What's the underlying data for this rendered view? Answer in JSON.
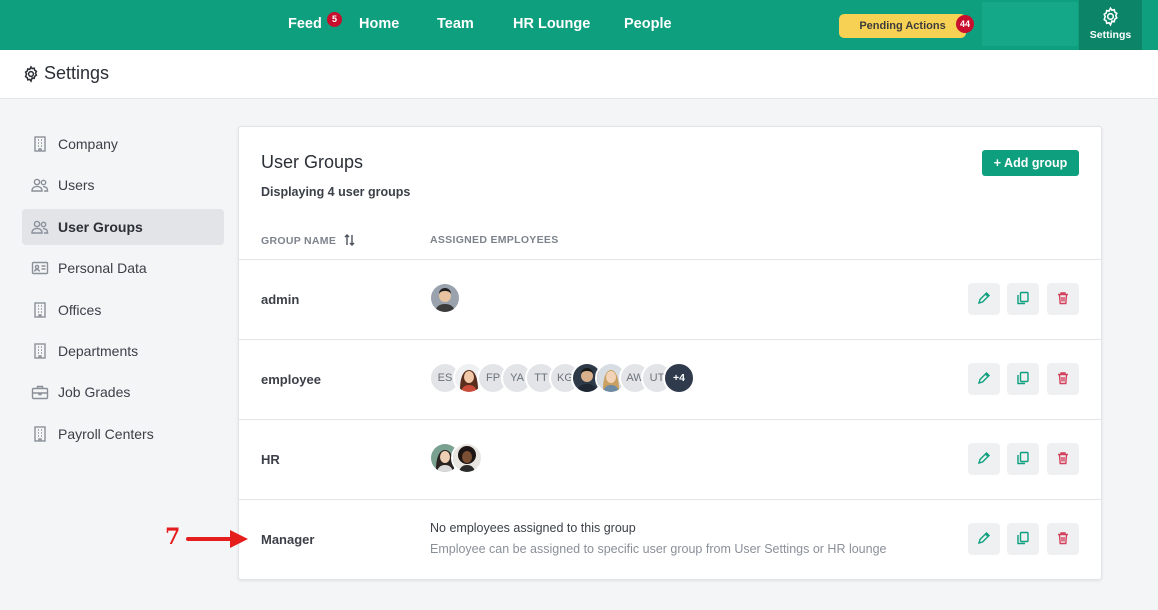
{
  "nav": {
    "links": [
      {
        "label": "Feed",
        "badge": "5"
      },
      {
        "label": "Home"
      },
      {
        "label": "Team"
      },
      {
        "label": "HR Lounge"
      },
      {
        "label": "People"
      }
    ],
    "pending_label": "Pending Actions",
    "pending_count": "44",
    "settings_label": "Settings",
    "settings_icon": "gear-icon"
  },
  "page": {
    "title": "Settings",
    "title_icon": "gear-icon"
  },
  "sidebar": {
    "items": [
      {
        "label": "Company",
        "icon": "building-icon"
      },
      {
        "label": "Users",
        "icon": "users-icon"
      },
      {
        "label": "User Groups",
        "icon": "users-icon",
        "active": true
      },
      {
        "label": "Personal Data",
        "icon": "id-card-icon"
      },
      {
        "label": "Offices",
        "icon": "building-icon"
      },
      {
        "label": "Departments",
        "icon": "building-icon"
      },
      {
        "label": "Job Grades",
        "icon": "briefcase-icon"
      },
      {
        "label": "Payroll Centers",
        "icon": "building-icon"
      }
    ]
  },
  "main": {
    "title": "User Groups",
    "subtitle": "Displaying 4 user groups",
    "add_button": "+ Add group",
    "columns": {
      "group_name": "GROUP NAME",
      "assigned": "ASSIGNED EMPLOYEES"
    },
    "rows": [
      {
        "name": "admin",
        "avatars": [
          {
            "type": "photo"
          }
        ]
      },
      {
        "name": "employee",
        "avatars": [
          {
            "type": "initials",
            "text": "ES"
          },
          {
            "type": "photo"
          },
          {
            "type": "initials",
            "text": "FP"
          },
          {
            "type": "initials",
            "text": "YA"
          },
          {
            "type": "initials",
            "text": "TT"
          },
          {
            "type": "initials",
            "text": "KG"
          },
          {
            "type": "photo"
          },
          {
            "type": "photo"
          },
          {
            "type": "initials",
            "text": "AW"
          },
          {
            "type": "initials",
            "text": "UT"
          },
          {
            "type": "more",
            "text": "+4"
          }
        ]
      },
      {
        "name": "HR",
        "avatars": [
          {
            "type": "photo"
          },
          {
            "type": "photo"
          }
        ]
      },
      {
        "name": "Manager",
        "empty": "No employees assigned to this group",
        "empty_hint": "Employee can be assigned to specific user group from User Settings or HR lounge"
      }
    ]
  },
  "annotation": {
    "number": "7",
    "color": "#e51d1d"
  },
  "colors": {
    "brand": "#0e9f7e",
    "pending": "#f7d154",
    "badge": "#c8102e",
    "delete": "#d4405a",
    "edit": "#0e9f7e"
  }
}
